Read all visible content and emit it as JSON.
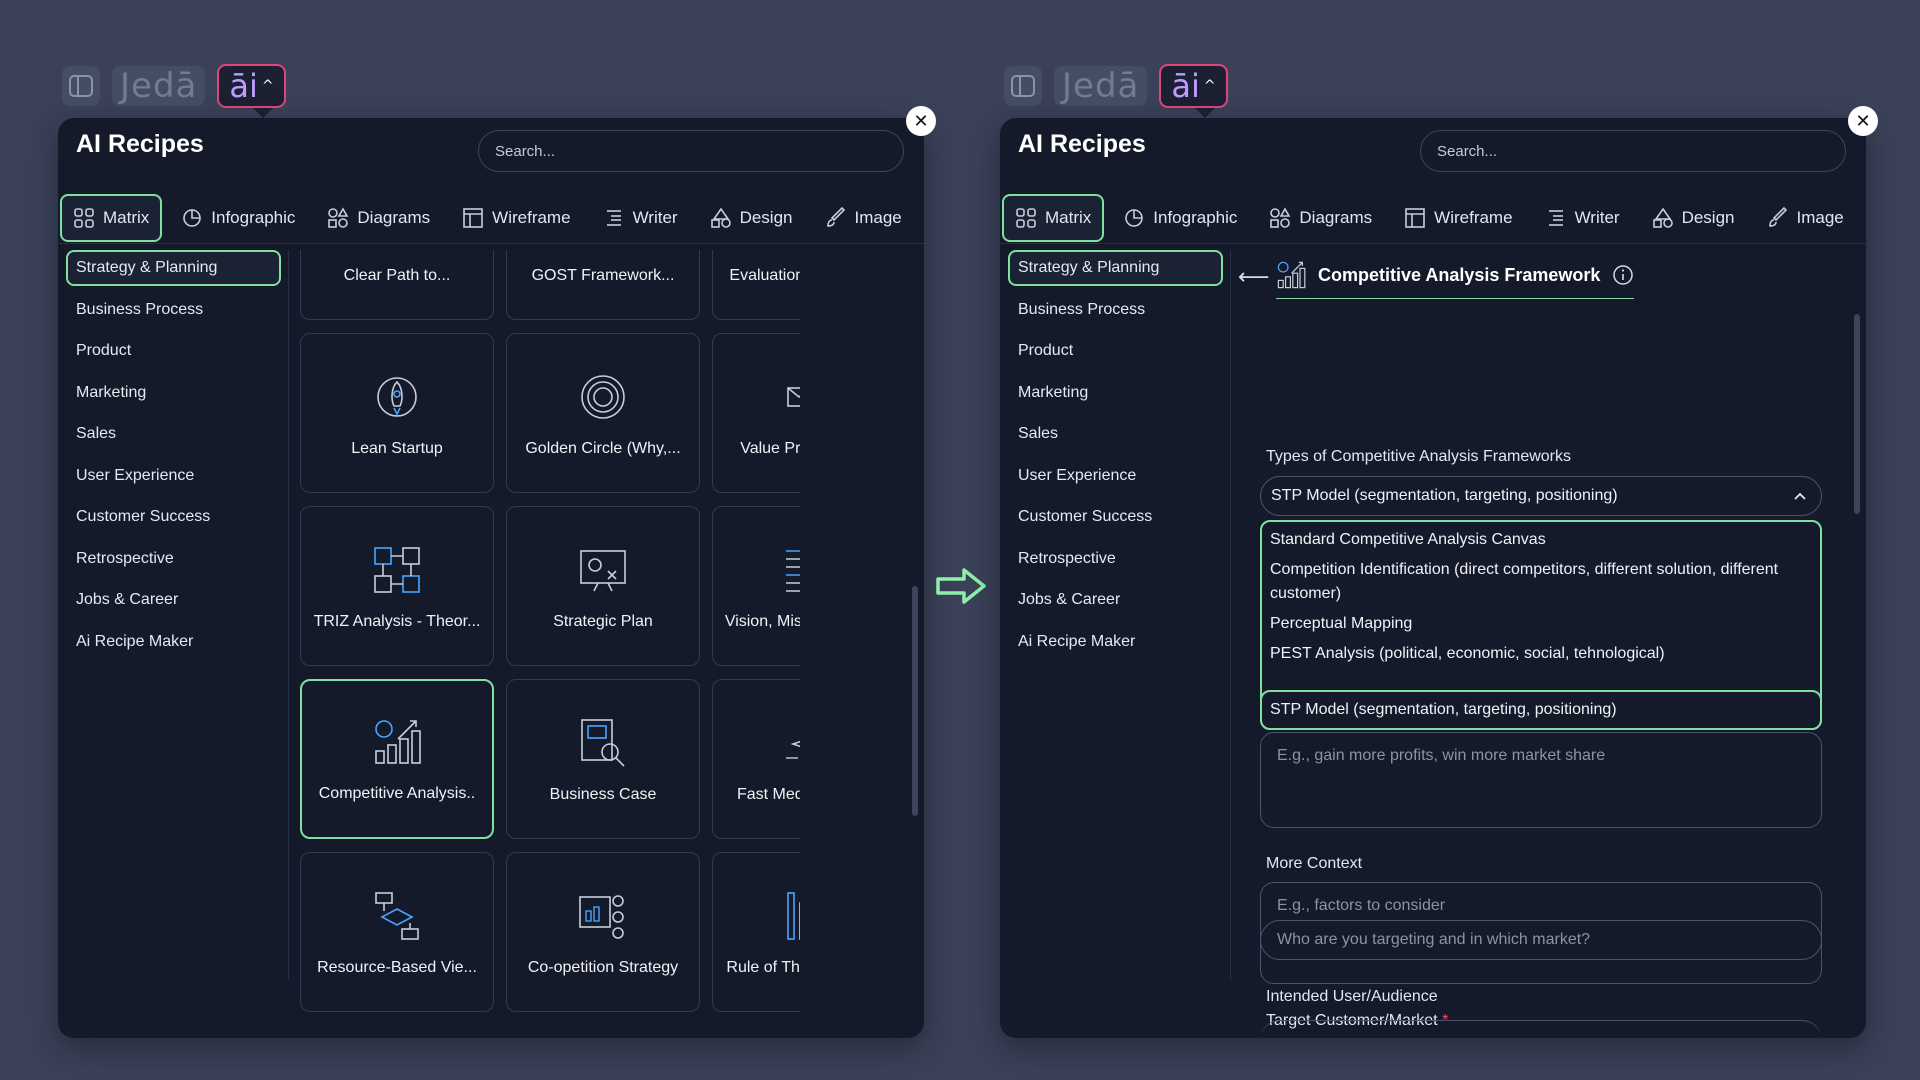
{
  "brand": {
    "logo": "Jedā",
    "ai": "āi"
  },
  "panel": {
    "title": "AI Recipes",
    "search_placeholder": "Search..."
  },
  "tabs": [
    {
      "label": "Matrix",
      "icon": "grid-icon"
    },
    {
      "label": "Infographic",
      "icon": "pie-chart-icon"
    },
    {
      "label": "Diagrams",
      "icon": "shapes-icon"
    },
    {
      "label": "Wireframe",
      "icon": "wireframe-icon"
    },
    {
      "label": "Writer",
      "icon": "list-icon"
    },
    {
      "label": "Design",
      "icon": "design-shapes-icon"
    },
    {
      "label": "Image",
      "icon": "brush-icon"
    }
  ],
  "sidebar": [
    "Strategy & Planning",
    "Business Process",
    "Product",
    "Marketing",
    "Sales",
    "User Experience",
    "Customer Success",
    "Retrospective",
    "Jobs & Career",
    "Ai Recipe Maker"
  ],
  "cards": [
    {
      "label": "Clear Path to...",
      "icon": "path-icon"
    },
    {
      "label": "GOST Framework...",
      "icon": "funnel-icon"
    },
    {
      "label": "Evaluation Framework",
      "icon": "evaluation-icon"
    },
    {
      "label": "Lean Startup",
      "icon": "rocket-icon"
    },
    {
      "label": "Golden Circle (Why,...",
      "icon": "target-circles-icon"
    },
    {
      "label": "Value Proposition...",
      "icon": "value-prop-icon"
    },
    {
      "label": "TRIZ Analysis - Theor...",
      "icon": "flow-boxes-icon"
    },
    {
      "label": "Strategic Plan",
      "icon": "presentation-board-icon"
    },
    {
      "label": "Vision, Mission, Value...",
      "icon": "text-lines-icon"
    },
    {
      "label": "Competitive Analysis..",
      "icon": "bar-growth-icon"
    },
    {
      "label": "Business Case",
      "icon": "report-magnifier-icon"
    },
    {
      "label": "Fast Medium Slow...",
      "icon": "sparkles-icon"
    },
    {
      "label": "Resource-Based Vie...",
      "icon": "hierarchy-icon"
    },
    {
      "label": "Co-opetition Strategy",
      "icon": "chart-people-icon"
    },
    {
      "label": "Rule of Three and Four",
      "icon": "bars-icon"
    }
  ],
  "detail": {
    "title": "Competitive Analysis Framework",
    "types_label": "Types of Competitive Analysis Frameworks",
    "selected_type": "STP Model (segmentation, targeting, positioning)",
    "options": [
      "Standard Competitive Analysis Canvas",
      "Competition Identification (direct competitors, different solution, different customer)",
      "Perceptual Mapping",
      "PEST Analysis (political, economic, social, tehnological)",
      "STP Model (segmentation, targeting, positioning)"
    ],
    "goal_placeholder": "E.g., gain more profits, win more market share",
    "more_context_label": "More Context",
    "more_context_placeholder": "E.g., factors to consider",
    "target_label": "Target Customer/Market",
    "target_required": "*",
    "target_placeholder": "Who are you targeting and in which market?",
    "audience_label": "Intended User/Audience"
  },
  "colors": {
    "background": "#3a4158",
    "panel": "#141a29",
    "accent_green": "#7fe0a0",
    "ai_border": "#e0457a",
    "ai_text": "#c09bff"
  }
}
